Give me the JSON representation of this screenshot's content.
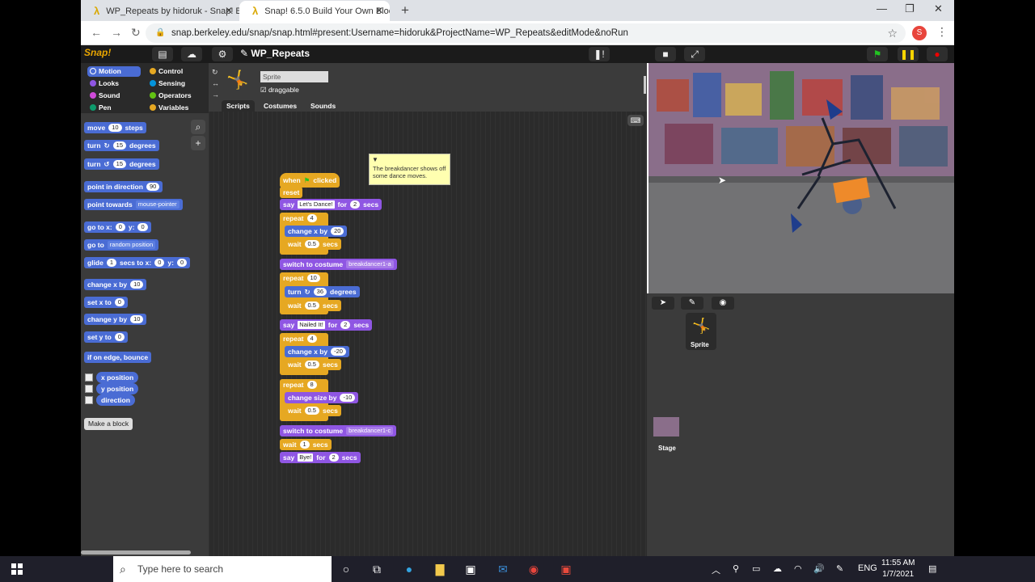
{
  "browser": {
    "tabs": [
      {
        "title": "WP_Repeats by hidoruk - Snap! B",
        "active": false
      },
      {
        "title": "Snap! 6.5.0 Build Your Own Block",
        "active": true
      }
    ],
    "url": "snap.berkeley.edu/snap/snap.html#present:Username=hidoruk&ProjectName=WP_Repeats&editMode&noRun",
    "profile_initial": "S"
  },
  "snap": {
    "logo": "Snap!",
    "project_name": "WP_Repeats",
    "categories": [
      {
        "label": "Motion",
        "color": "#4a6cd4"
      },
      {
        "label": "Control",
        "color": "#e6a822"
      },
      {
        "label": "Looks",
        "color": "#8f56e3"
      },
      {
        "label": "Sensing",
        "color": "#0494dc"
      },
      {
        "label": "Sound",
        "color": "#cf4ad9"
      },
      {
        "label": "Operators",
        "color": "#62c213"
      },
      {
        "label": "Pen",
        "color": "#0e9a6c"
      },
      {
        "label": "Variables",
        "color": "#e6a822"
      }
    ],
    "palette": {
      "move": "move",
      "move_val": "10",
      "steps": "steps",
      "turn": "turn",
      "turn_val": "15",
      "degrees": "degrees",
      "point_dir": "point in direction",
      "point_dir_val": "90",
      "point_towards": "point towards",
      "point_towards_val": "mouse-pointer",
      "goto_xy": "go to x:",
      "y_label": "y:",
      "zero": "0",
      "goto": "go to",
      "goto_val": "random position",
      "glide": "glide",
      "glide_val": "1",
      "glide_secs": "secs to x:",
      "change_x": "change x by",
      "set_x": "set x to",
      "change_y": "change y by",
      "set_y": "set y to",
      "ten": "10",
      "bounce": "if on edge, bounce",
      "x_position": "x position",
      "y_position": "y position",
      "direction": "direction",
      "make_block": "Make a block"
    },
    "sprite": {
      "name": "Sprite",
      "draggable": "draggable",
      "tabs": [
        "Scripts",
        "Costumes",
        "Sounds"
      ]
    },
    "script": {
      "when": "when",
      "clicked": "clicked",
      "reset": "reset",
      "say": "say",
      "for": "for",
      "secs": "secs",
      "say1": "Let's Dance!",
      "say1_secs": "2",
      "repeat": "repeat",
      "r1": "4",
      "cx1": "20",
      "wait": "wait",
      "wait_val": "0.5",
      "switch": "switch to costume",
      "costume1": "breakdancer1-a",
      "r2": "10",
      "turn_val": "36",
      "say2": "Nailed It!",
      "say2_secs": "2",
      "r3": "4",
      "cx3": "-20",
      "r4": "8",
      "change_size": "change size by",
      "cs_val": "-10",
      "costume2": "breakdancer1-c",
      "wait1": "1",
      "say3": "Bye!",
      "say3_secs": "2"
    },
    "comment": "The breakdancer shows off some dance moves.",
    "corral": {
      "sprite_label": "Sprite",
      "stage_label": "Stage"
    }
  },
  "taskbar": {
    "search_placeholder": "Type here to search",
    "lang": "ENG",
    "time": "11:55 AM",
    "date": "1/7/2021"
  }
}
